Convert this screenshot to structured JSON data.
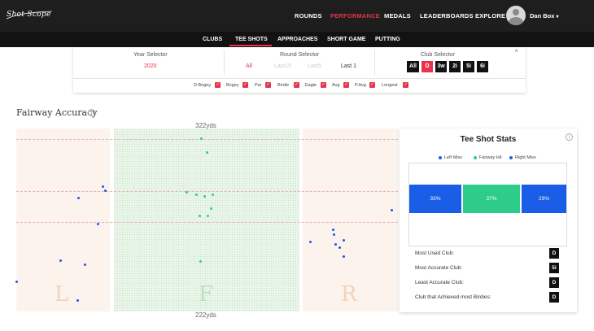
{
  "header": {
    "logo_text": "Shot Scope",
    "nav": [
      {
        "label": "ROUNDS",
        "active": false
      },
      {
        "label": "PERFORMANCE",
        "active": true
      },
      {
        "label": "MEDALS",
        "active": false
      },
      {
        "label": "LEADERBOARDS",
        "active": false
      },
      {
        "label": "EXPLORE",
        "active": false
      }
    ],
    "user_name": "Dan Box",
    "user_caret": "▾"
  },
  "subnav": [
    {
      "label": "CLUBS",
      "active": false
    },
    {
      "label": "TEE SHOTS",
      "active": true
    },
    {
      "label": "APPROACHES",
      "active": false
    },
    {
      "label": "SHORT GAME",
      "active": false
    },
    {
      "label": "PUTTING",
      "active": false
    }
  ],
  "filters": {
    "year_selector_label": "Year Selector",
    "year_value": "2020",
    "round_selector_label": "Round Selector",
    "round_options": [
      {
        "label": "All",
        "state": "all"
      },
      {
        "label": "Last15",
        "state": "disabled"
      },
      {
        "label": "Last5",
        "state": "disabled"
      },
      {
        "label": "Last 1",
        "state": "selected"
      }
    ],
    "club_selector_label": "Club Selector",
    "clubs": [
      {
        "label": "All",
        "active": false
      },
      {
        "label": "D",
        "active": true
      },
      {
        "label": "3w",
        "active": false
      },
      {
        "label": "2i",
        "active": false
      },
      {
        "label": "5i",
        "active": false
      },
      {
        "label": "6i",
        "active": false
      }
    ],
    "collapse_icon": "^",
    "score_filters": [
      "D.Bogey",
      "Bogey",
      "Par",
      "Birdie",
      "Eagle",
      "Avg",
      "P.Avg",
      "Longest"
    ],
    "check_glyph": "✓"
  },
  "fairway": {
    "title": "Fairway Accuracy",
    "info_glyph": "i",
    "top_yards": "322yds",
    "bottom_yards": "222yds",
    "zone_left": "L",
    "zone_fairway": "F",
    "zone_right": "R",
    "colors": {
      "left_miss": "#2255ee",
      "fairway_hit": "#2ecc8a",
      "right_miss": "#2255ee",
      "zone_letter_side": "#f2d3bd",
      "zone_letter_fairway": "#bde0bd"
    },
    "shots": {
      "left_miss": 9,
      "fairway_hit": 11,
      "right_miss": 9
    }
  },
  "stats": {
    "title": "Tee Shot Stats",
    "info_glyph": "i",
    "legend": [
      {
        "label": "Left Miss",
        "color": "#1a5ee8"
      },
      {
        "label": "Fairway Hit",
        "color": "#2ecc8a"
      },
      {
        "label": "Right Miss",
        "color": "#1a5ee8"
      }
    ],
    "bars": [
      {
        "label": "33%",
        "value": 33,
        "color": "#1a5ee8"
      },
      {
        "label": "37%",
        "value": 37,
        "color": "#2ecc8a"
      },
      {
        "label": "29%",
        "value": 29,
        "color": "#1a5ee8"
      }
    ],
    "rows": [
      {
        "label": "Most Used Club:",
        "value": "D"
      },
      {
        "label": "Most Accurate Club:",
        "value": "5i"
      },
      {
        "label": "Least Accurate Club:",
        "value": "D"
      },
      {
        "label": "Club that Achieved most Birdies:",
        "value": "D"
      }
    ]
  }
}
